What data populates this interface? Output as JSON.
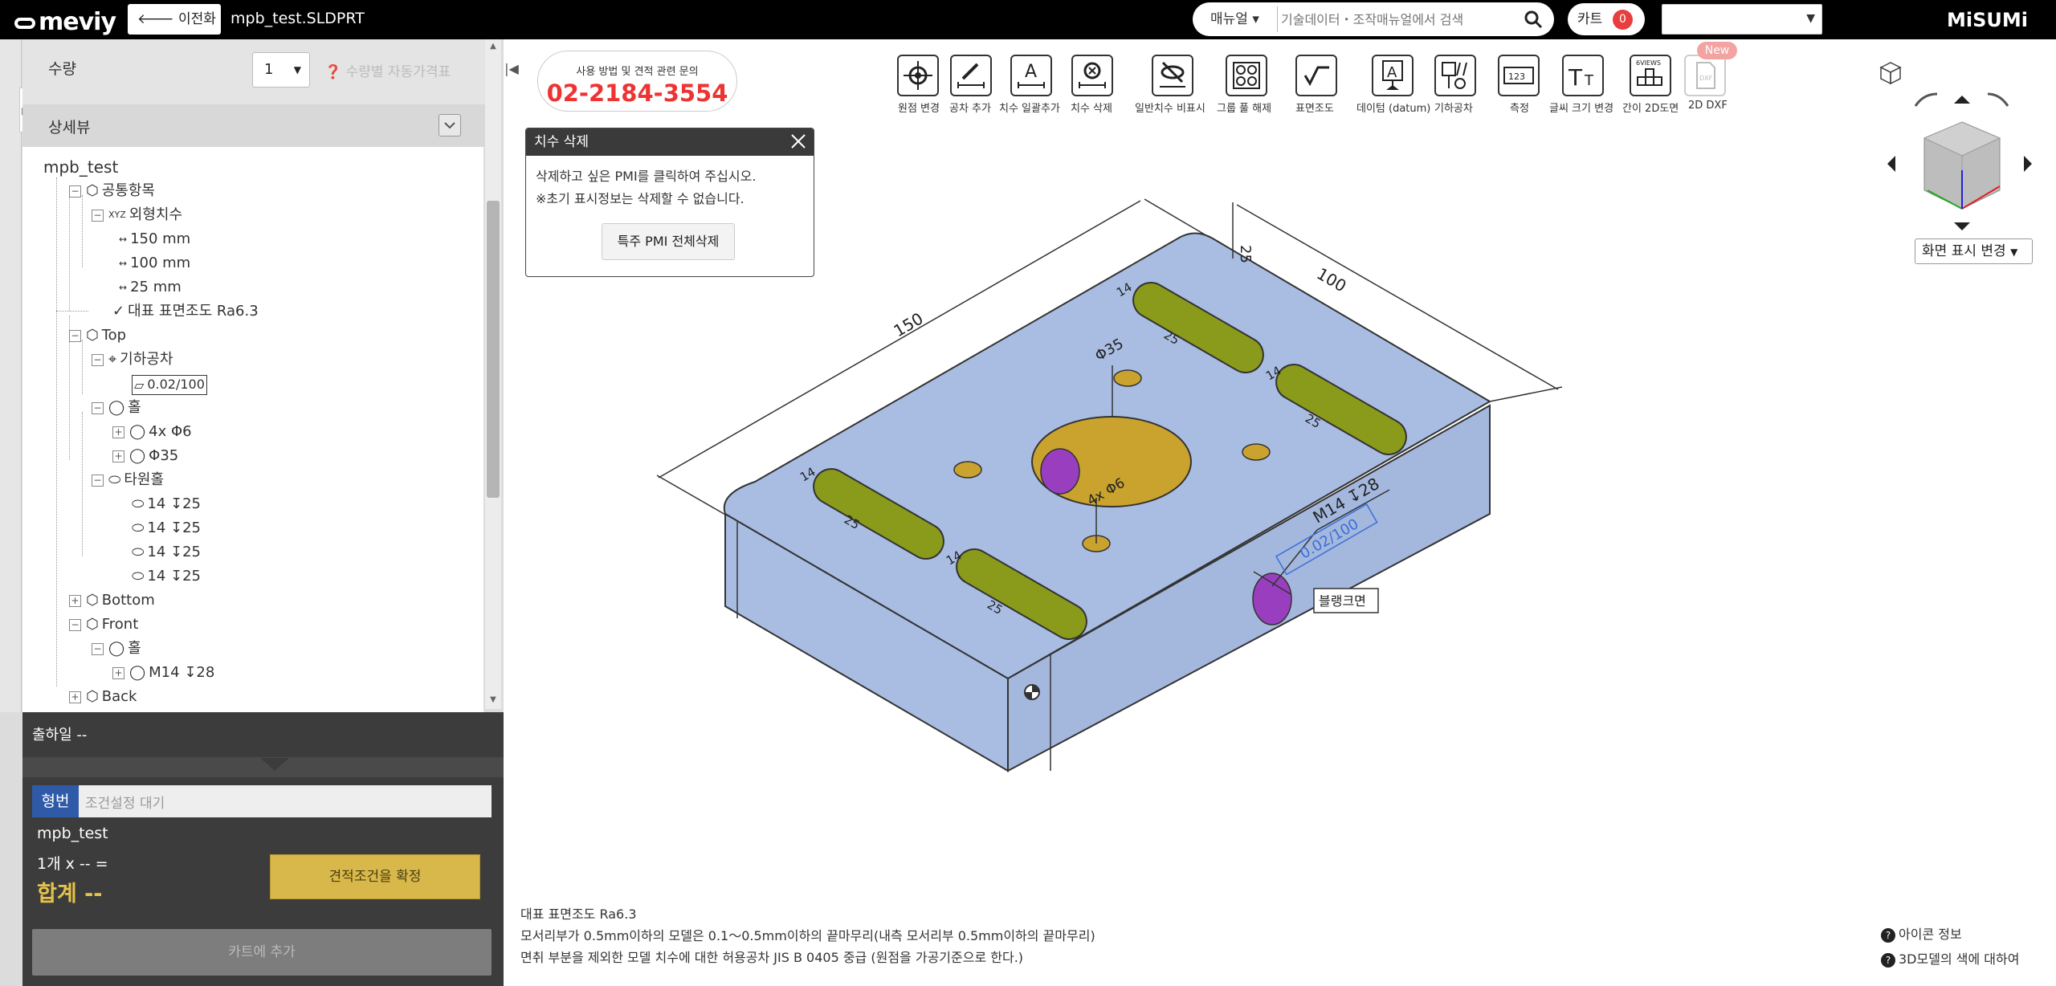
{
  "topbar": {
    "logo": "meviy",
    "back_label": "이전화면",
    "file_name": "mpb_test.SLDPRT",
    "search_category": "매뉴얼",
    "search_placeholder": "기술데이터・조작매뉴얼에서 검색",
    "cart_label": "카트",
    "cart_count": "0",
    "brand": "MiSUMi"
  },
  "sidebar": {
    "qty_label": "수량",
    "qty_value": "1",
    "auto_price": "수량별 자동가격표",
    "detail_label": "상세뷰",
    "tree": {
      "root": "mpb_test",
      "common": "공통항목",
      "outer_dim": "외형치수",
      "dim_x": "150 mm",
      "dim_y": "100 mm",
      "dim_z": "25 mm",
      "roughness": "대표 표면조도 Ra6.3",
      "top": "Top",
      "geo_tol": "기하공차",
      "geo_val": "0.02/100",
      "hole": "홀",
      "hole_a": "4x Φ6",
      "hole_b": "Φ35",
      "slot": "타원홀",
      "slot_1": "14 ↧25",
      "slot_2": "14 ↧25",
      "slot_3": "14 ↧25",
      "slot_4": "14 ↧25",
      "bottom": "Bottom",
      "front": "Front",
      "front_hole": "홀",
      "front_hole_a": "M14 ↧28",
      "back": "Back"
    },
    "ship_date": "출하일 --",
    "part_label": "형번",
    "part_value": "조건설정 대기",
    "part_name": "mpb_test",
    "qty_calc": "1개 x -- =",
    "total": "합계 --",
    "confirm": "견적조건을 확정",
    "add_cart": "카트에 추가"
  },
  "contact": {
    "text": "사용 방법 및 견적 관련 문의",
    "phone": "02-2184-3554"
  },
  "toolbar": {
    "items": [
      "원점 변경",
      "공차 추가",
      "치수 일괄추가",
      "치수 삭제",
      "일반치수 비표시",
      "그룹 풀 해제",
      "표면조도",
      "데이텀 (datum)",
      "기하공차",
      "측정",
      "글씨 크기 변경",
      "간이 2D도면",
      "2D DXF"
    ],
    "new_badge": "New",
    "sixviews": "6VIEWS"
  },
  "popup": {
    "title": "치수 삭제",
    "line1": "삭제하고 싶은 PMI를 클릭하여 주십시오.",
    "line2": "※초기 표시정보는 삭제할 수 없습니다.",
    "button": "특주 PMI 전체삭제"
  },
  "model": {
    "dim_150": "150",
    "dim_100": "100",
    "dim_25": "25",
    "phi35": "Φ35",
    "holes4": "4x Φ6",
    "m14": "M14 ↧28",
    "flat": "0.02/100",
    "blank": "블랭크면",
    "slot_w": "14",
    "slot_d": "25"
  },
  "view": {
    "change_label": "화면 표시 변경"
  },
  "footer": {
    "line1": "대표 표면조도 Ra6.3",
    "line2": "모서리부가 0.5mm이하의 모델은 0.1～0.5mm이하의 끝마무리(내측 모서리부 0.5mm이하의 끝마무리)",
    "line3": "면취 부분을 제외한 모델 치수에 대한 허용공차 JIS B 0405 중급 (원점을 가공기준으로 한다.)",
    "icon_info": "아이콘 정보",
    "color_info": "3D모델의 색에 대하여"
  },
  "colors": {
    "accent": "#2f5aa8",
    "model_face": "#a9bde3",
    "slot": "#8a9a1a",
    "hole_big": "#c9a32e",
    "highlight": "#9a3ec0",
    "phone": "#e33333"
  }
}
